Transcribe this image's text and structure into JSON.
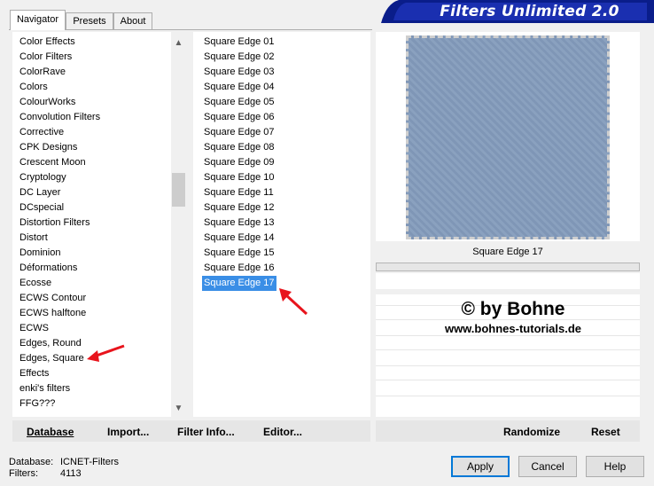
{
  "tabs": [
    {
      "label": "Navigator",
      "active": true
    },
    {
      "label": "Presets",
      "active": false
    },
    {
      "label": "About",
      "active": false
    }
  ],
  "title": "Filters Unlimited 2.0",
  "categories": [
    "Color Effects",
    "Color Filters",
    "ColorRave",
    "Colors",
    "ColourWorks",
    "Convolution Filters",
    "Corrective",
    "CPK Designs",
    "Crescent Moon",
    "Cryptology",
    "DC Layer",
    "DCspecial",
    "Distortion Filters",
    "Distort",
    "Dominion",
    "Déformations",
    "Ecosse",
    "ECWS Contour",
    "ECWS halftone",
    "ECWS",
    "Edges, Round",
    "Edges, Square",
    "Effects",
    "enki's filters",
    "FFG???"
  ],
  "filters": [
    "Square Edge 01",
    "Square Edge 02",
    "Square Edge 03",
    "Square Edge 04",
    "Square Edge 05",
    "Square Edge 06",
    "Square Edge 07",
    "Square Edge 08",
    "Square Edge 09",
    "Square Edge 10",
    "Square Edge 11",
    "Square Edge 12",
    "Square Edge 13",
    "Square Edge 14",
    "Square Edge 15",
    "Square Edge 16",
    "Square Edge 17"
  ],
  "selected_filter": "Square Edge 17",
  "preview": {
    "label": "Square Edge 17",
    "color": "#7f96b6"
  },
  "watermark": {
    "line1": "© by Bohne",
    "line2": "www.bohnes-tutorials.de"
  },
  "bottom_links": {
    "database": "Database",
    "import": "Import...",
    "filter_info": "Filter Info...",
    "editor": "Editor...",
    "randomize": "Randomize",
    "reset": "Reset"
  },
  "buttons": {
    "apply": "Apply",
    "cancel": "Cancel",
    "help": "Help"
  },
  "status": {
    "db_label": "Database:",
    "db_value": "ICNET-Filters",
    "filters_label": "Filters:",
    "filters_value": "4113"
  },
  "colors": {
    "accent": "#0a1d8a",
    "selection": "#3a8ee6",
    "arrow": "#e8141c"
  }
}
